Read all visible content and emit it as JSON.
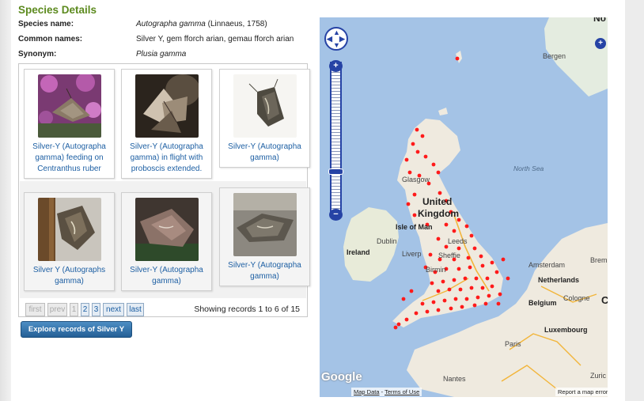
{
  "section_title": "Species Details",
  "details": [
    {
      "label": "Species name:",
      "value_italic": "Autographa gamma",
      "value_rest": " (Linnaeus, 1758)"
    },
    {
      "label": "Common names:",
      "value_italic": "",
      "value_rest": "Silver Y, gem fforch arian, gemau fforch arian"
    },
    {
      "label": "Synonym:",
      "value_italic": "Plusia gamma",
      "value_rest": ""
    }
  ],
  "gallery": {
    "cards": [
      {
        "caption": "Silver-Y (Autographa gamma) feeding on Centranthus ruber",
        "photo": "moth-on-pink-flower"
      },
      {
        "caption": "Silver-Y (Autographa gamma) in flight with proboscis extended.",
        "photo": "moth-in-flight"
      },
      {
        "caption": "Silver-Y (Autographa gamma)",
        "photo": "moth-on-white"
      },
      {
        "caption": "Silver Y (Autographs gamma)",
        "photo": "moth-on-wood"
      },
      {
        "caption": "Silver-Y (Autographa gamma)",
        "photo": "moth-close-up"
      },
      {
        "caption": "Silver-Y (Autographa gamma)",
        "photo": "moth-on-stone"
      }
    ],
    "pager": {
      "first": "first",
      "prev": "prev",
      "pages": [
        "1",
        "2",
        "3"
      ],
      "next": "next",
      "last": "last"
    },
    "showing": "Showing records 1 to 6 of 15"
  },
  "explore_button": "Explore records of Silver Y",
  "map": {
    "labels": {
      "bergen": "Bergen",
      "north_sea": "North Sea",
      "glasgow": "Glasgow",
      "uk_1": "United",
      "uk_2": "Kingdom",
      "isle_of_man": "Isle of Man",
      "dublin": "Dublin",
      "ireland": "Ireland",
      "liverpool": "Liverp",
      "sheffield": "Sheffie",
      "leeds": "Leeds",
      "birmingham": "Birmin",
      "amsterdam": "Amsterdam",
      "netherlands": "Netherlands",
      "bremen": "Brem",
      "belgium": "Belgium",
      "cologne": "Cologne",
      "luxembourg_city": "Luxembourg",
      "paris": "Paris",
      "nantes": "Nantes",
      "zurich": "Zuric",
      "no_top": "No",
      "c_edge": "C"
    },
    "footer": {
      "map_data": "Map Data",
      "sep": " - ",
      "terms": "Terms of Use",
      "report": "Report a map error"
    },
    "logo": "Google",
    "colors": {
      "land": "#efeadf",
      "sea": "#a4c3e6",
      "records": "#ff1a1a",
      "controls": "#2643a5"
    }
  }
}
